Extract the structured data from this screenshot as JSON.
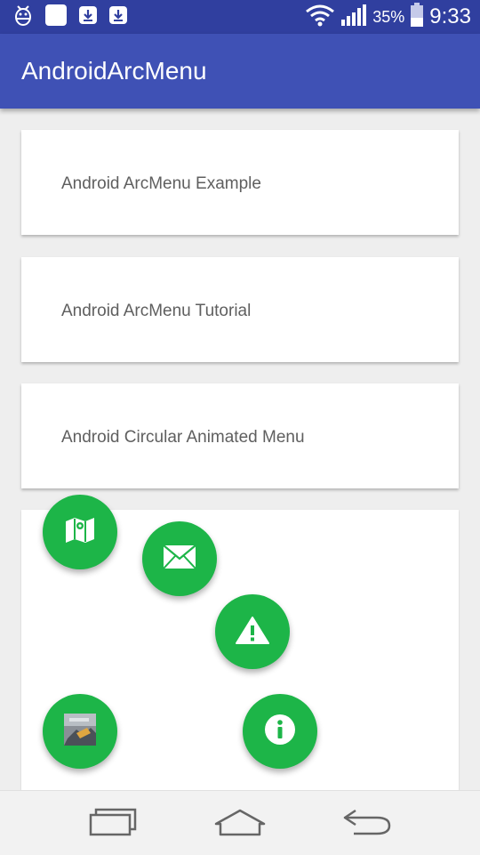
{
  "status_bar": {
    "battery_percent": "35%",
    "time": "9:33",
    "icons": [
      "android-debug-icon",
      "notification-square-icon",
      "download-icon",
      "download-icon",
      "wifi-icon",
      "signal-icon",
      "battery-icon"
    ]
  },
  "app_bar": {
    "title": "AndroidArcMenu"
  },
  "cards": [
    {
      "label": "Android ArcMenu Example"
    },
    {
      "label": "Android ArcMenu Tutorial"
    },
    {
      "label": "Android Circular Animated Menu"
    }
  ],
  "arc_menu": {
    "fab_color": "#1db548",
    "items": [
      "map-icon",
      "mail-icon",
      "warning-icon",
      "info-icon"
    ],
    "toggle": "image-thumbnail-icon"
  },
  "nav_bar": {
    "buttons": [
      "recent-apps-icon",
      "home-icon",
      "back-icon"
    ]
  },
  "colors": {
    "primary": "#3f51b5",
    "primary_dark": "#303f9f",
    "accent": "#1db548",
    "background": "#eeeeee"
  }
}
